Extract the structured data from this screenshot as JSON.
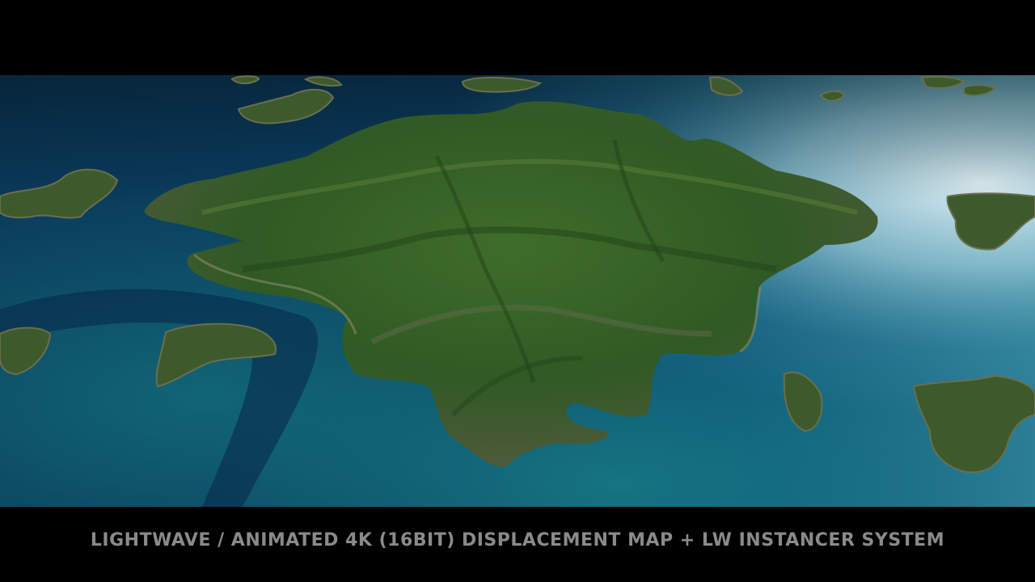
{
  "video_frame": {
    "caption": "LIGHTWAVE / ANIMATED 4K (16BIT) DISPLACEMENT MAP + LW INSTANCER SYSTEM",
    "caption_color": "#8a8a8a",
    "letterbox_color": "#000000"
  },
  "scene": {
    "subject": "aerial-island-archipelago",
    "colors": {
      "deep_ocean": "#05233f",
      "shallow_ocean": "#0d6a78",
      "sun_glare": "#d8ecf2",
      "island_green": "#2f5a24",
      "island_cliff": "#5b6144"
    }
  }
}
